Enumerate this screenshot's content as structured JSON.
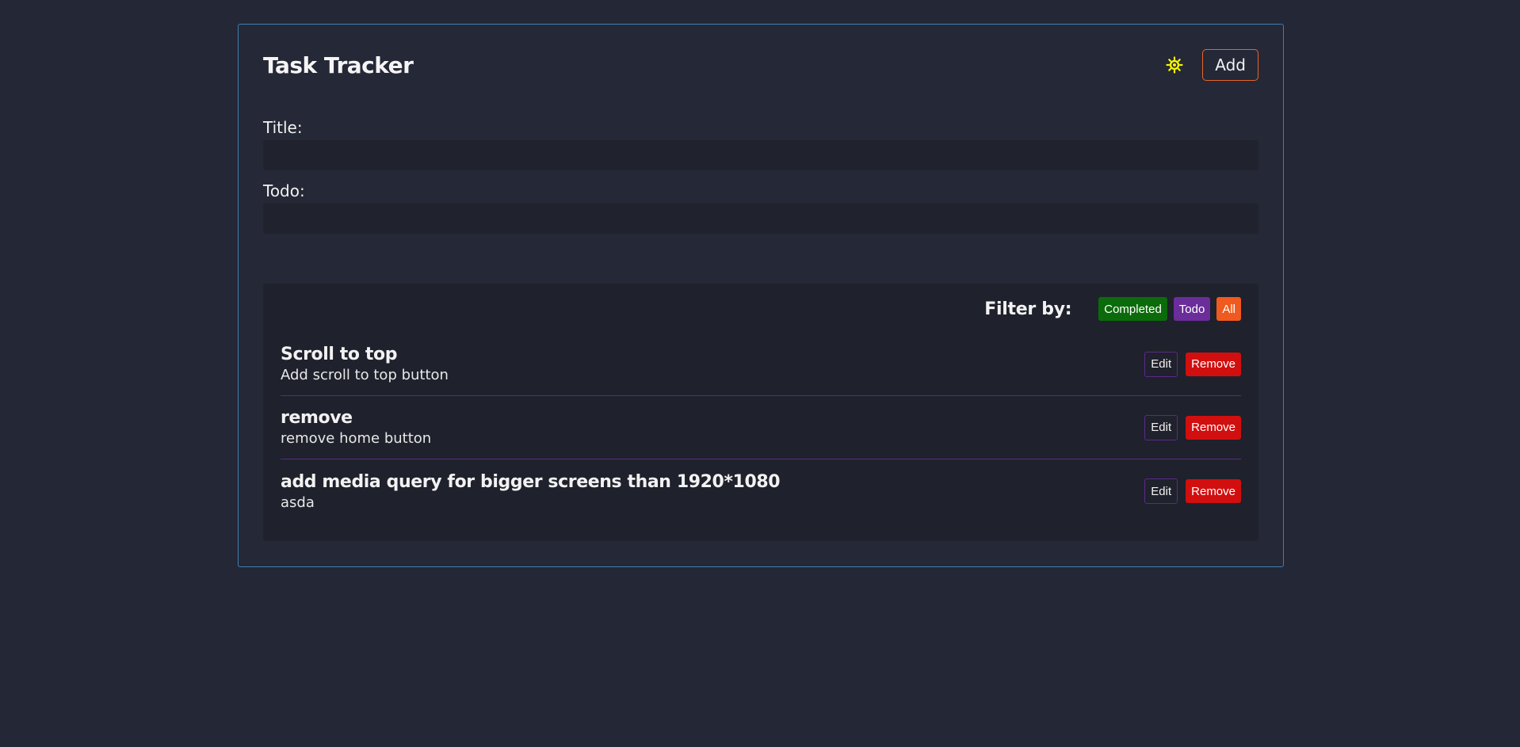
{
  "header": {
    "title": "Task Tracker",
    "theme_icon": "sun-icon",
    "add_label": "Add"
  },
  "form": {
    "title_label": "Title:",
    "title_value": "",
    "todo_label": "Todo:",
    "todo_value": ""
  },
  "filter": {
    "label": "Filter by:",
    "options": [
      "Completed",
      "Todo",
      "All"
    ]
  },
  "tasks": [
    {
      "title": "Scroll to top",
      "description": "Add scroll to top button"
    },
    {
      "title": "remove",
      "description": "remove home button"
    },
    {
      "title": "add media query for bigger screens than 1920*1080",
      "description": "asda"
    }
  ],
  "task_actions": {
    "edit_label": "Edit",
    "remove_label": "Remove"
  },
  "colors": {
    "background": "#242736",
    "border": "#3f7fb0",
    "accent": "#e8642c",
    "completed": "#0b6b0b",
    "todo": "#6a2d9a",
    "all": "#f05a1e",
    "remove": "#d20f0f",
    "sun": "#f5f500"
  }
}
